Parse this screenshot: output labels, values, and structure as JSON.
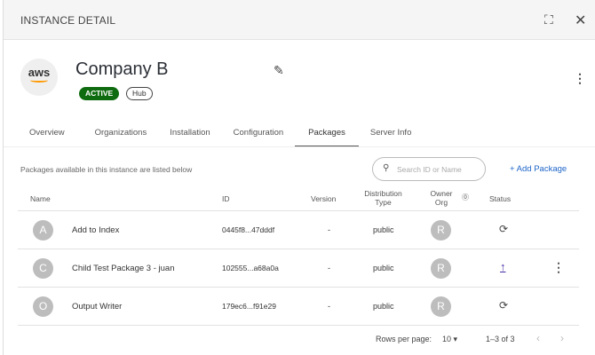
{
  "header": {
    "title": "INSTANCE DETAIL"
  },
  "instance": {
    "logo": "aws",
    "name": "Company B",
    "status": "ACTIVE",
    "tag": "Hub"
  },
  "tabs": [
    "Overview",
    "Organizations",
    "Installation",
    "Configuration",
    "Packages",
    "Server Info"
  ],
  "packages": {
    "description": "Packages available in this instance are listed below",
    "search_placeholder": "Search ID or Name",
    "add_label": "+ Add Package",
    "columns": {
      "name": "Name",
      "id": "ID",
      "version": "Version",
      "dist": "Distribution Type",
      "owner": "Owner Org",
      "status": "Status"
    },
    "rows": [
      {
        "initial": "A",
        "name": "Add to Index",
        "id": "0445f8...47dddf",
        "version": "-",
        "dist": "public",
        "owner": "R",
        "status": "pending"
      },
      {
        "initial": "C",
        "name": "Child Test Package 3 - juan",
        "id": "102555...a68a0a",
        "version": "-",
        "dist": "public",
        "owner": "R",
        "status": "upload"
      },
      {
        "initial": "O",
        "name": "Output Writer",
        "id": "179ec6...f91e29",
        "version": "-",
        "dist": "public",
        "owner": "R",
        "status": "pending"
      }
    ]
  },
  "pagination": {
    "rows_label": "Rows per page:",
    "rows_value": "10",
    "range": "1–3 of 3"
  }
}
